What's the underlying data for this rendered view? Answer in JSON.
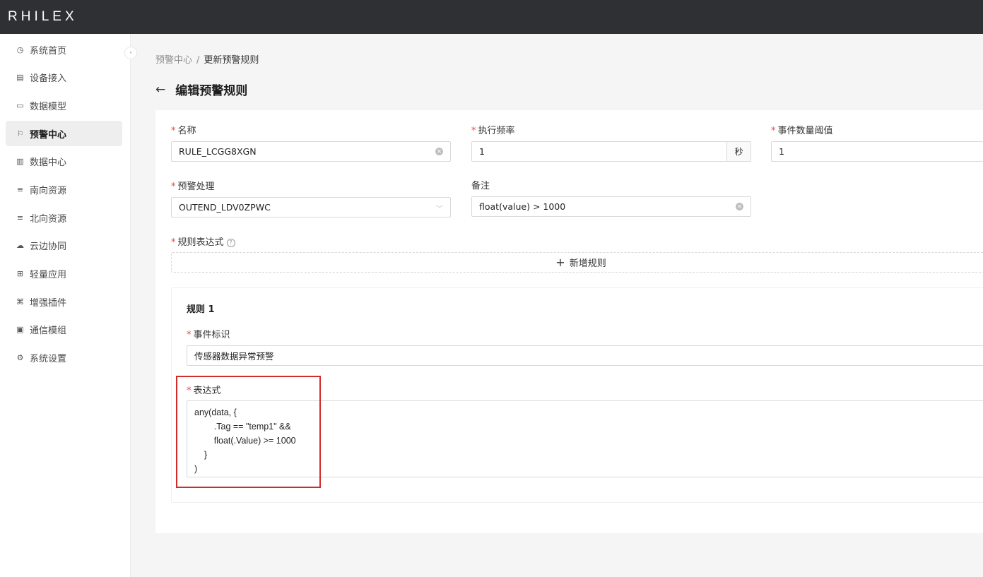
{
  "app": {
    "logo": "RHILEX"
  },
  "sidebar": {
    "collapse_icon": "chevron-left-icon",
    "items": [
      {
        "label": "系统首页",
        "icon": "dashboard-icon",
        "glyph": "◷"
      },
      {
        "label": "设备接入",
        "icon": "device-icon",
        "glyph": "▤"
      },
      {
        "label": "数据模型",
        "icon": "model-icon",
        "glyph": "▭"
      },
      {
        "label": "预警中心",
        "icon": "alarm-icon",
        "glyph": "⚐",
        "active": true
      },
      {
        "label": "数据中心",
        "icon": "data-icon",
        "glyph": "▥"
      },
      {
        "label": "南向资源",
        "icon": "south-icon",
        "glyph": "≡"
      },
      {
        "label": "北向资源",
        "icon": "north-icon",
        "glyph": "≡"
      },
      {
        "label": "云边协同",
        "icon": "cloud-icon",
        "glyph": "☁"
      },
      {
        "label": "轻量应用",
        "icon": "app-icon",
        "glyph": "⊞"
      },
      {
        "label": "增强插件",
        "icon": "plugin-icon",
        "glyph": "⌘"
      },
      {
        "label": "通信模组",
        "icon": "chip-icon",
        "glyph": "▣"
      },
      {
        "label": "系统设置",
        "icon": "gear-icon",
        "glyph": "⚙"
      }
    ]
  },
  "breadcrumb": {
    "parent": "预警中心",
    "separator": "/",
    "current": "更新预警规则"
  },
  "page": {
    "title": "编辑预警规则",
    "back_glyph": "←"
  },
  "form": {
    "name": {
      "label": "名称",
      "value": "RULE_LCGG8XGN"
    },
    "frequency": {
      "label": "执行频率",
      "value": "1",
      "unit": "秒"
    },
    "threshold": {
      "label": "事件数量阈值",
      "value": "1"
    },
    "handler": {
      "label": "预警处理",
      "value": "OUTEND_LDV0ZPWC"
    },
    "remark": {
      "label": "备注",
      "value": "float(value) > 1000"
    },
    "expressions_label": "规则表达式",
    "add_rule_label": "新增规则",
    "required_mark": "*"
  },
  "rules": [
    {
      "title": "规则 1",
      "event_label": "事件标识",
      "event_value": "传感器数据异常预警",
      "expr_label": "表达式",
      "expr_value": "any(data, {\n        .Tag == \"temp1\" &&\n        float(.Value) >= 1000\n    }\n)"
    }
  ],
  "colors": {
    "topbar": "#2e3033",
    "required": "#e5484d",
    "highlight": "#d42a2a"
  }
}
